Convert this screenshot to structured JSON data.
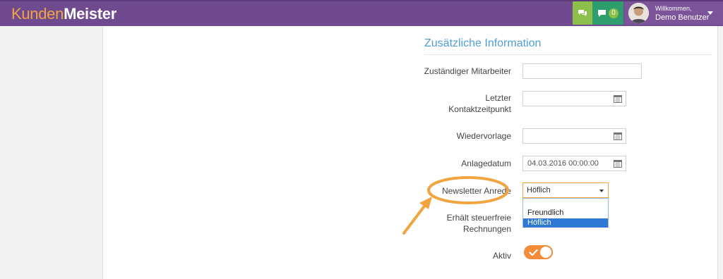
{
  "brand": {
    "part1": "Kunden",
    "part2": "Meister"
  },
  "header": {
    "chat_icon": "chat-bubbles-icon",
    "message_icon": "comment-icon",
    "message_count": "0",
    "greeting": "Willkommen,",
    "user_name": "Demo Benutzer"
  },
  "section": {
    "title": "Zusätzliche Information"
  },
  "fields": {
    "mitarbeiter": {
      "label": "Zuständiger Mitarbeiter",
      "value": ""
    },
    "kontakt": {
      "label_line1": "Letzter",
      "label_line2": "Kontaktzeitpunkt",
      "value": ""
    },
    "wiedervorlage": {
      "label": "Wiedervorlage",
      "value": ""
    },
    "anlagedatum": {
      "label": "Anlagedatum",
      "value": "04.03.2016 00:00:00"
    },
    "newsletter": {
      "label": "Newsletter Anrede",
      "selected": "Höflich",
      "options": [
        "Freundlich",
        "Höflich"
      ]
    },
    "steuerfrei": {
      "label_line1": "Erhält steuerfreie",
      "label_line2": "Rechnungen"
    },
    "aktiv": {
      "label": "Aktiv",
      "checked": true
    }
  },
  "colors": {
    "header": "#6f4a8e",
    "accent": "#f28c38",
    "brand": "#f0a541",
    "title": "#4f9fd6"
  }
}
